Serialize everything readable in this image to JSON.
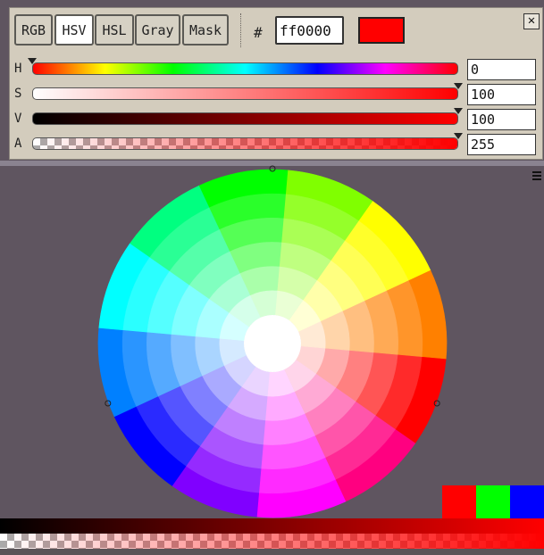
{
  "tabs": [
    {
      "label": "RGB",
      "active": false
    },
    {
      "label": "HSV",
      "active": true
    },
    {
      "label": "HSL",
      "active": false
    },
    {
      "label": "Gray",
      "active": false
    },
    {
      "label": "Mask",
      "active": false
    }
  ],
  "hex": {
    "prefix": "#",
    "value": "ff0000"
  },
  "preview_color": "#ff0000",
  "close_icon": "close-icon",
  "sliders": [
    {
      "label": "H",
      "value": "0",
      "fraction": 0.0
    },
    {
      "label": "S",
      "value": "100",
      "fraction": 1.0
    },
    {
      "label": "V",
      "value": "100",
      "fraction": 1.0
    },
    {
      "label": "A",
      "value": "255",
      "fraction": 1.0
    }
  ],
  "quick_swatches": [
    "#ff0000",
    "#00ff00",
    "#0000ff"
  ],
  "colors": {
    "panel": "#d3ccbd",
    "canvas": "#5f5560",
    "accent": "#ff0000"
  }
}
